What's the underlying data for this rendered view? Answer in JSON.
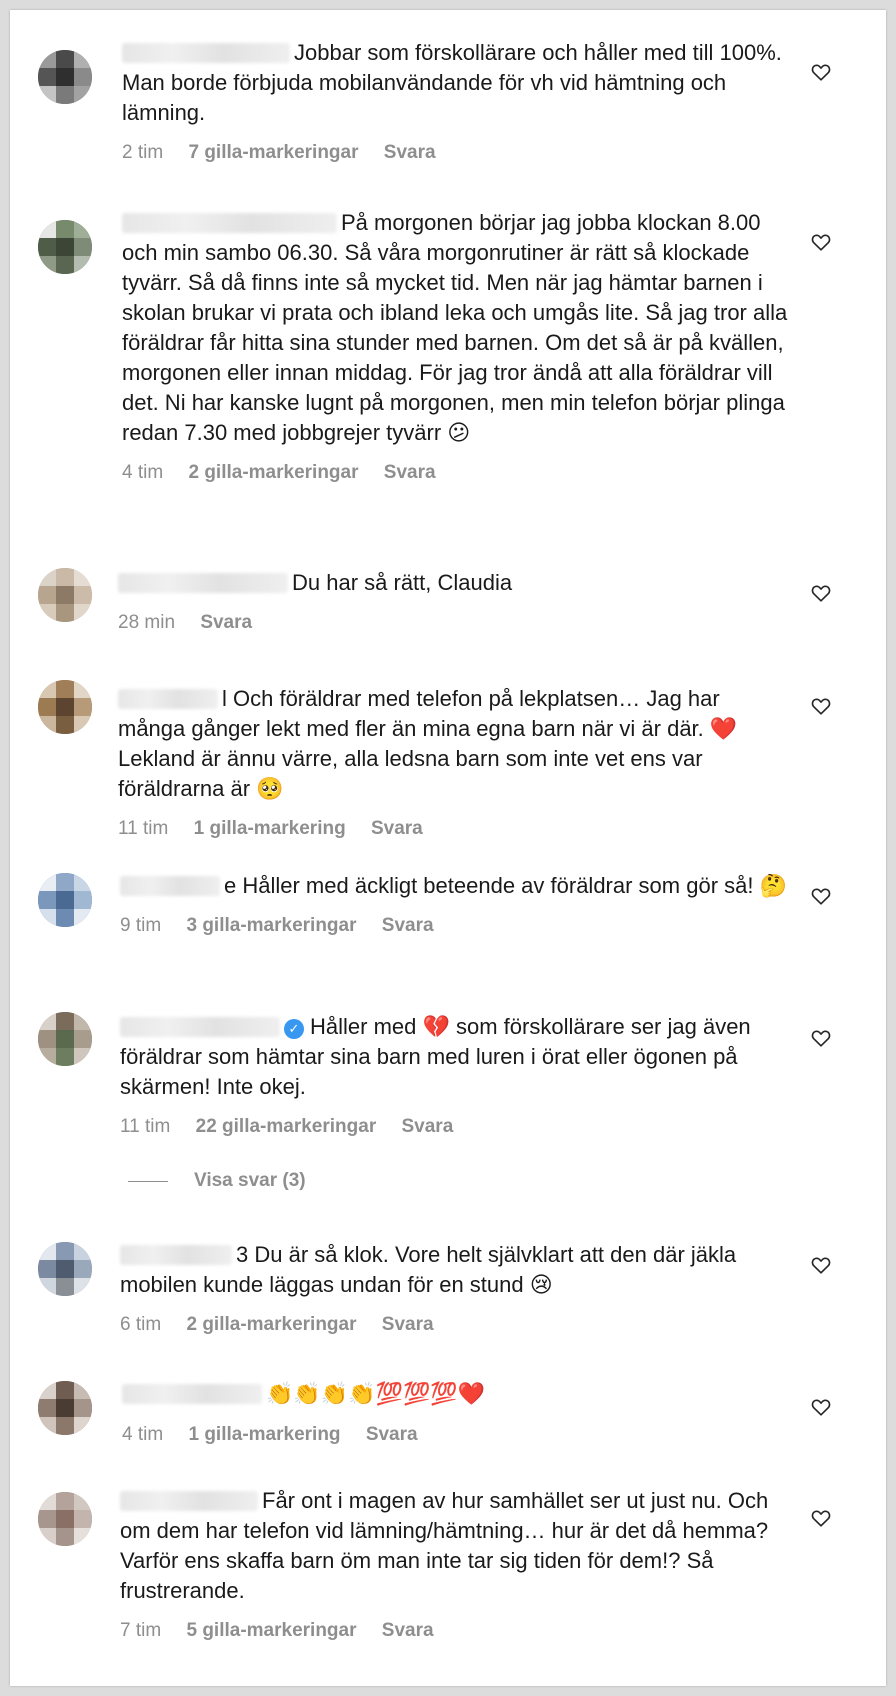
{
  "comments": [
    {
      "text": "Jobbar som förskollärare och håller med till 100%. Man borde förbjuda mobilanvändande för vh vid hämtning och lämning.",
      "time": "2 tim",
      "likes": "7 gilla-markeringar",
      "reply": "Svara"
    },
    {
      "text": "På morgonen börjar jag jobba klockan 8.00 och min sambo 06.30. Så våra morgonrutiner är rätt så klockade tyvärr. Så då finns inte så mycket tid. Men när jag hämtar barnen i skolan brukar vi prata och ibland leka och umgås lite. Så jag tror alla föräldrar får hitta sina stunder med barnen. Om det så är på kvällen, morgonen eller innan middag. För jag tror ändå att alla föräldrar vill det. Ni har kanske lugnt på morgonen, men min telefon börjar plinga redan 7.30 med jobbgrejer tyvärr 😕",
      "time": "4 tim",
      "likes": "2 gilla-markeringar",
      "reply": "Svara"
    },
    {
      "text": "Du har så rätt, Claudia",
      "time": "28 min",
      "likes": "",
      "reply": "Svara"
    },
    {
      "text": "l Och föräldrar med telefon på lekplatsen… Jag har många gånger lekt med fler än mina egna barn när vi är där. ❤️ Lekland är ännu värre, alla ledsna barn som inte vet ens var föräldrarna är 🥺",
      "time": "11 tim",
      "likes": "1 gilla-markering",
      "reply": "Svara"
    },
    {
      "text": "e Håller med äckligt beteende av föräldrar som gör så! 🤔",
      "time": "9 tim",
      "likes": "3 gilla-markeringar",
      "reply": "Svara"
    },
    {
      "text": "Håller med 💔 som förskollärare ser jag även föräldrar som hämtar sina barn med luren i örat eller ögonen på skärmen! Inte okej.",
      "time": "11 tim",
      "likes": "22 gilla-markeringar",
      "reply": "Svara"
    },
    {
      "text": "3 Du är så klok. Vore helt självklart att den där jäkla mobilen kunde läggas undan för en stund 😢",
      "time": "6 tim",
      "likes": "2 gilla-markeringar",
      "reply": "Svara"
    },
    {
      "text": "👏👏👏👏💯💯💯❤️",
      "time": "4 tim",
      "likes": "1 gilla-markering",
      "reply": "Svara"
    },
    {
      "text": "Får ont i magen av hur samhället ser ut just nu. Och om dem har telefon vid lämning/hämtning… hur är det då hemma? Varför ens skaffa barn öm man inte tar sig tiden för dem!? Så frustrerande.",
      "time": "7 tim",
      "likes": "5 gilla-markeringar",
      "reply": "Svara"
    }
  ],
  "view_replies": "Visa svar (3)",
  "icons": {
    "like": "heart-outline-icon",
    "verified": "verified-badge-icon"
  },
  "colors": {
    "text": "#1a1a1a",
    "meta": "#8e8e8e",
    "verified": "#3897f0"
  }
}
